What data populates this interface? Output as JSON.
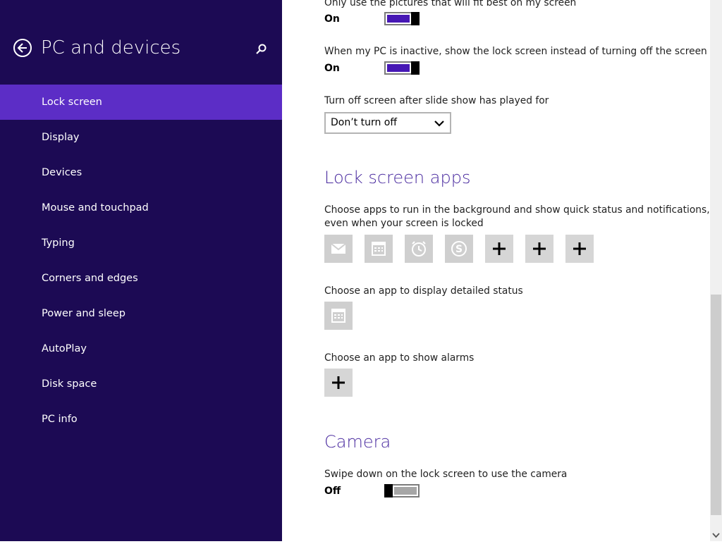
{
  "sidebar": {
    "title": "PC and devices",
    "items": [
      {
        "label": "Lock screen"
      },
      {
        "label": "Display"
      },
      {
        "label": "Devices"
      },
      {
        "label": "Mouse and touchpad"
      },
      {
        "label": "Typing"
      },
      {
        "label": "Corners and edges"
      },
      {
        "label": "Power and sleep"
      },
      {
        "label": "AutoPlay"
      },
      {
        "label": "Disk space"
      },
      {
        "label": "PC info"
      }
    ],
    "active_item": "Lock screen"
  },
  "main": {
    "fit_pictures": {
      "label": "Only use the pictures that will fit best on my screen",
      "state": "On"
    },
    "inactive_lock": {
      "label": "When my PC is inactive, show the lock screen instead of turning off the screen",
      "state": "On"
    },
    "slideshow_off": {
      "label": "Turn off screen after slide show has played for",
      "value": "Don’t turn off"
    },
    "lock_screen_apps": {
      "heading": "Lock screen apps",
      "description_line1": "Choose apps to run in the background and show quick status and notifications,",
      "description_line2": "even when your screen is locked",
      "apps": [
        "mail-icon",
        "calendar-icon",
        "alarms-icon",
        "skype-icon",
        "add-icon",
        "add-icon",
        "add-icon"
      ],
      "detailed_status_label": "Choose an app to display detailed status",
      "detailed_status_app": "calendar-icon",
      "alarms_label": "Choose an app to show alarms",
      "alarms_app": "add-icon"
    },
    "camera": {
      "heading": "Camera",
      "label": "Swipe down on the lock screen to use the camera",
      "state": "Off"
    }
  },
  "colors": {
    "sidebar_bg": "#1c0a54",
    "active_item_bg": "#5c2dc6",
    "toggle_on": "#4617b4",
    "heading": "#4b2ca0"
  }
}
